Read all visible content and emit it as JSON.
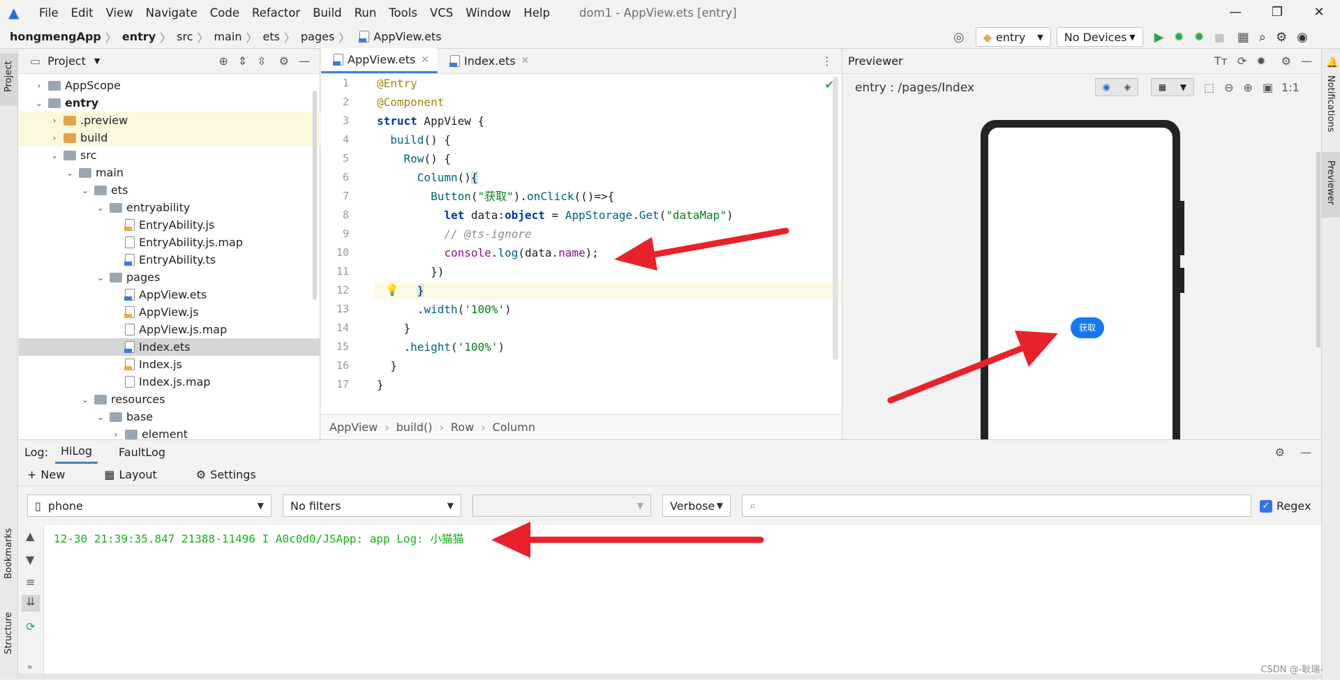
{
  "menubar": {
    "items": [
      "File",
      "Edit",
      "View",
      "Navigate",
      "Code",
      "Refactor",
      "Build",
      "Run",
      "Tools",
      "VCS",
      "Window",
      "Help"
    ],
    "title": "dom1 - AppView.ets [entry]"
  },
  "navbar": {
    "crumbs": [
      "hongmengApp",
      "entry",
      "src",
      "main",
      "ets",
      "pages",
      "AppView.ets"
    ],
    "config_select": "entry",
    "device_select": "No Devices"
  },
  "project": {
    "title": "Project",
    "tree": [
      {
        "label": "AppScope",
        "depth": 0,
        "type": "folder",
        "arrow": ">"
      },
      {
        "label": "entry",
        "depth": 0,
        "type": "folder",
        "arrow": "v",
        "bold": true
      },
      {
        "label": ".preview",
        "depth": 1,
        "type": "folder-orange",
        "arrow": ">"
      },
      {
        "label": "build",
        "depth": 1,
        "type": "folder-orange",
        "arrow": ">"
      },
      {
        "label": "src",
        "depth": 1,
        "type": "folder",
        "arrow": "v"
      },
      {
        "label": "main",
        "depth": 2,
        "type": "folder",
        "arrow": "v"
      },
      {
        "label": "ets",
        "depth": 3,
        "type": "folder",
        "arrow": "v"
      },
      {
        "label": "entryability",
        "depth": 4,
        "type": "folder",
        "arrow": "v"
      },
      {
        "label": "EntryAbility.js",
        "depth": 5,
        "type": "js",
        "arrow": ""
      },
      {
        "label": "EntryAbility.js.map",
        "depth": 5,
        "type": "map",
        "arrow": ""
      },
      {
        "label": "EntryAbility.ts",
        "depth": 5,
        "type": "ts",
        "arrow": ""
      },
      {
        "label": "pages",
        "depth": 4,
        "type": "folder",
        "arrow": "v"
      },
      {
        "label": "AppView.ets",
        "depth": 5,
        "type": "ts",
        "arrow": ""
      },
      {
        "label": "AppView.js",
        "depth": 5,
        "type": "js",
        "arrow": ""
      },
      {
        "label": "AppView.js.map",
        "depth": 5,
        "type": "map",
        "arrow": ""
      },
      {
        "label": "Index.ets",
        "depth": 5,
        "type": "ts",
        "arrow": "",
        "selected": true
      },
      {
        "label": "Index.js",
        "depth": 5,
        "type": "js",
        "arrow": ""
      },
      {
        "label": "Index.js.map",
        "depth": 5,
        "type": "map",
        "arrow": ""
      },
      {
        "label": "resources",
        "depth": 3,
        "type": "folder",
        "arrow": "v"
      },
      {
        "label": "base",
        "depth": 4,
        "type": "folder",
        "arrow": "v"
      },
      {
        "label": "element",
        "depth": 5,
        "type": "folder",
        "arrow": ">"
      }
    ]
  },
  "editor": {
    "tabs": [
      {
        "label": "AppView.ets",
        "active": true
      },
      {
        "label": "Index.ets",
        "active": false
      }
    ],
    "line_numbers": [
      "1",
      "2",
      "3",
      "4",
      "5",
      "6",
      "7",
      "8",
      "9",
      "10",
      "11",
      "12",
      "13",
      "14",
      "15",
      "16",
      "17"
    ],
    "crumbs": [
      "AppView",
      "build()",
      "Row",
      "Column"
    ]
  },
  "previewer": {
    "title": "Previewer",
    "path": "entry : /pages/Index",
    "button_label": "获取",
    "zoom_label": "1:1"
  },
  "log": {
    "label": "Log:",
    "tabs": [
      "HiLog",
      "FaultLog"
    ],
    "tools": [
      "New",
      "Layout",
      "Settings"
    ],
    "device": "phone",
    "filter": "No filters",
    "level": "Verbose",
    "regex_label": "Regex",
    "line": "12-30 21:39:35.847 21388-11496 I A0c0d0/JSApp: app Log: 小猫猫"
  },
  "sidebars": {
    "left_top": "Project",
    "left_bottom_1": "Bookmarks",
    "left_bottom_2": "Structure",
    "right_top": "Notifications",
    "right_mid": "Previewer"
  },
  "watermark": "CSDN @-耿瑞-",
  "colors": {
    "accent": "#4083c9",
    "log_green": "#16b416",
    "button_blue": "#1578f2",
    "arrow_red": "#e8222a"
  }
}
